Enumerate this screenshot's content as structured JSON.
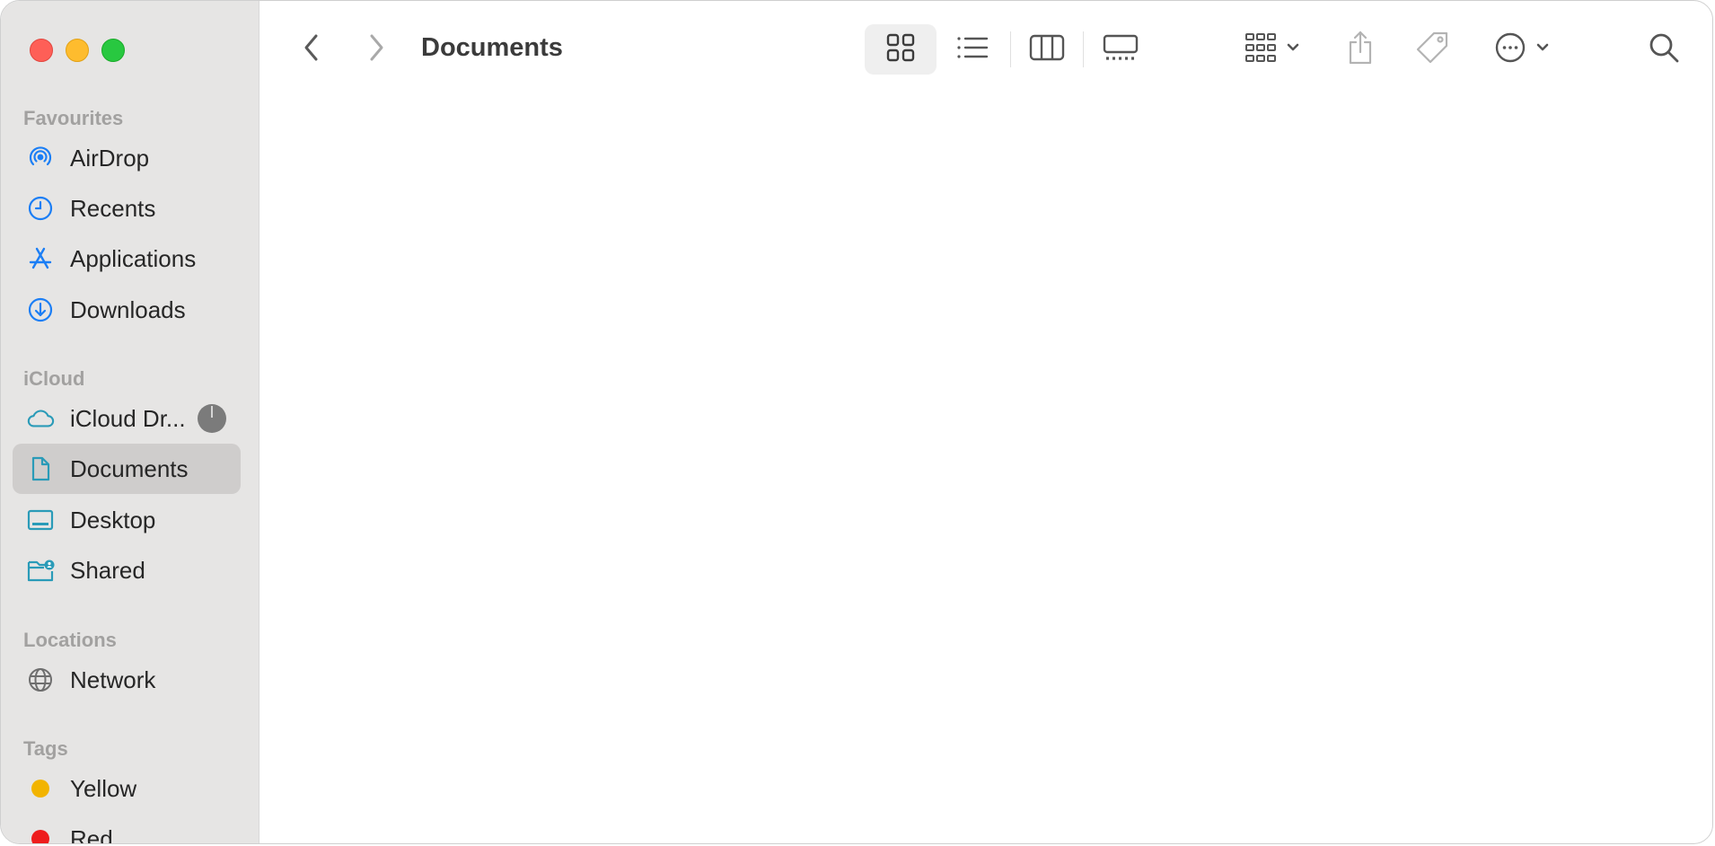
{
  "window": {
    "title": "Documents"
  },
  "sidebar": {
    "sections": {
      "favourites": "Favourites",
      "icloud": "iCloud",
      "locations": "Locations",
      "tags": "Tags"
    },
    "favourites": [
      {
        "label": "AirDrop",
        "icon": "airdrop-icon"
      },
      {
        "label": "Recents",
        "icon": "clock-icon"
      },
      {
        "label": "Applications",
        "icon": "app-store-icon"
      },
      {
        "label": "Downloads",
        "icon": "download-icon"
      }
    ],
    "icloud": [
      {
        "label": "iCloud Dr...",
        "icon": "cloud-icon"
      },
      {
        "label": "Documents",
        "icon": "document-icon",
        "selected": true
      },
      {
        "label": "Desktop",
        "icon": "desktop-icon"
      },
      {
        "label": "Shared",
        "icon": "shared-folder-icon"
      }
    ],
    "locations": [
      {
        "label": "Network",
        "icon": "globe-icon"
      }
    ],
    "tags": [
      {
        "label": "Yellow",
        "color": "#f2b400"
      },
      {
        "label": "Red",
        "color": "#ee1c1c"
      }
    ]
  },
  "toolbar": {
    "view_modes": [
      "icon-view",
      "list-view",
      "column-view",
      "gallery-view"
    ],
    "selected_view": "icon-view"
  },
  "colors": {
    "accent": "#1b7ef5",
    "teal": "#2a9bb8",
    "sidebar_bg": "#e6e5e4",
    "selected_bg": "#cfcdcc"
  }
}
